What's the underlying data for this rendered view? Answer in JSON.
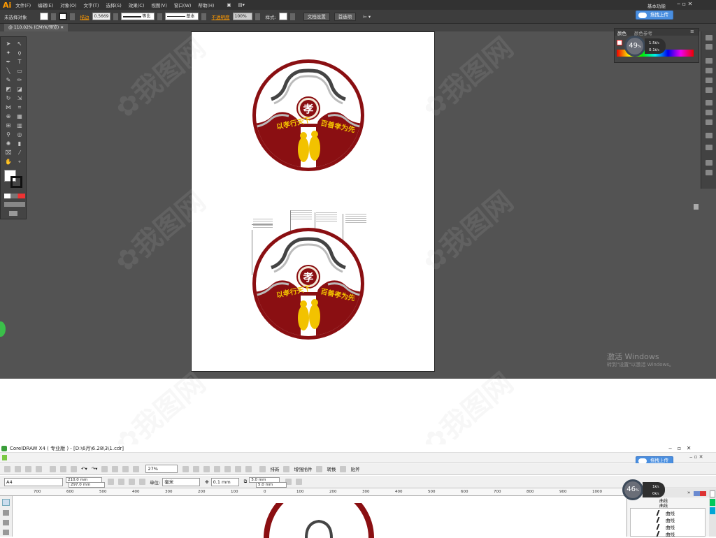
{
  "illustrator": {
    "logo": "Ai",
    "menu": [
      "文件(F)",
      "编辑(E)",
      "对象(O)",
      "文字(T)",
      "选择(S)",
      "效果(C)",
      "视图(V)",
      "窗口(W)",
      "帮助(H)"
    ],
    "workspace": "基本功能",
    "control": {
      "selection": "未选择对象",
      "stroke_label": "描边",
      "stroke_value": "0.5669",
      "profile1": "等比",
      "profile2": "基本",
      "opacity_label": "不透明度",
      "opacity_value": "100%",
      "style_label": "样式:",
      "doc_setup": "文档设置",
      "prefs": "首选项"
    },
    "doc_tab": "@ 110.02% (CMYK/预览)",
    "color_panel": {
      "tab1": "颜色",
      "tab2": "颜色参考"
    },
    "win_activate": {
      "title": "激活 Windows",
      "sub": "转到\"设置\"以激活 Windows。"
    },
    "upload_btn": "拖拽上传"
  },
  "speedball_ai": {
    "percent": "49",
    "suffix": "%",
    "up": "1.5",
    "up_unit": "K/s",
    "down": "0.1",
    "down_unit": "K/s"
  },
  "speedball_cd": {
    "percent": "46",
    "suffix": "%",
    "up": "1",
    "up_unit": "K/s",
    "down": "0",
    "down_unit": "K/s"
  },
  "artwork": {
    "center_char": "孝",
    "left_text": "以孝行天下",
    "right_text": "百善孝为先"
  },
  "coreldraw": {
    "title": "CorelDRAW X4 ( 专业版 ) - [D:\\6月\\6.28\\3\\1.cdr]",
    "zoom": "27%",
    "toolbar_btns": [
      "排新",
      "增强插件",
      "转换",
      "贴斧"
    ],
    "page_size": "A4",
    "width": "210.0 mm",
    "height": "297.0 mm",
    "unit_label": "单位:",
    "unit": "毫米",
    "nudge": "0.1 mm",
    "dup_x": "5.0 mm",
    "dup_y": "5.0 mm",
    "ruler_labels": [
      "700",
      "600",
      "500",
      "400",
      "300",
      "200",
      "100",
      "0",
      "100",
      "200",
      "300",
      "400",
      "500",
      "600",
      "700",
      "800",
      "900",
      "1000"
    ],
    "objects": [
      "曲线",
      "曲线",
      "曲线",
      "曲线"
    ],
    "layer_labels": [
      "曲线",
      "曲线"
    ],
    "upload_btn": "拖拽上传"
  }
}
